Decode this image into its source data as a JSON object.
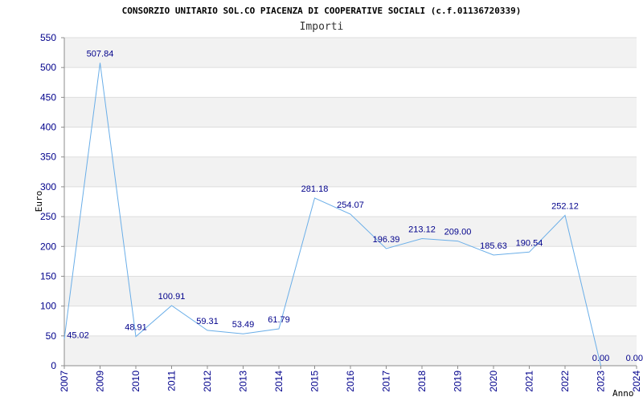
{
  "chart_data": {
    "type": "line",
    "title": "CONSORZIO UNITARIO SOL.CO PIACENZA DI COOPERATIVE SOCIALI (c.f.01136720339)",
    "subtitle": "Importi",
    "xlabel": "Anno",
    "ylabel": "Euro",
    "ylim": [
      0,
      550
    ],
    "yticks": [
      "0",
      "50",
      "100",
      "150",
      "200",
      "250",
      "300",
      "350",
      "400",
      "450",
      "500",
      "550"
    ],
    "categories": [
      "2007",
      "2009",
      "2010",
      "2011",
      "2012",
      "2013",
      "2014",
      "2015",
      "2016",
      "2017",
      "2018",
      "2019",
      "2020",
      "2021",
      "2022",
      "2023",
      "2024"
    ],
    "values": [
      45.02,
      507.84,
      48.91,
      100.91,
      59.31,
      53.49,
      61.79,
      281.18,
      254.07,
      196.39,
      213.12,
      209.0,
      185.63,
      190.54,
      252.12,
      0.0,
      0.0
    ],
    "value_labels": [
      "45.02",
      "507.84",
      "48.91",
      "100.91",
      "59.31",
      "53.49",
      "61.79",
      "281.18",
      "254.07",
      "196.39",
      "213.12",
      "209.00",
      "185.63",
      "190.54",
      "252.12",
      "0.00",
      "0.00"
    ],
    "line_color": "#6aaee8",
    "band_color": "#f2f2f2",
    "grid_color": "#dddddd",
    "axis_color": "#8c8c8c",
    "label_color": "#00008b",
    "grid": true,
    "legend": "none"
  }
}
